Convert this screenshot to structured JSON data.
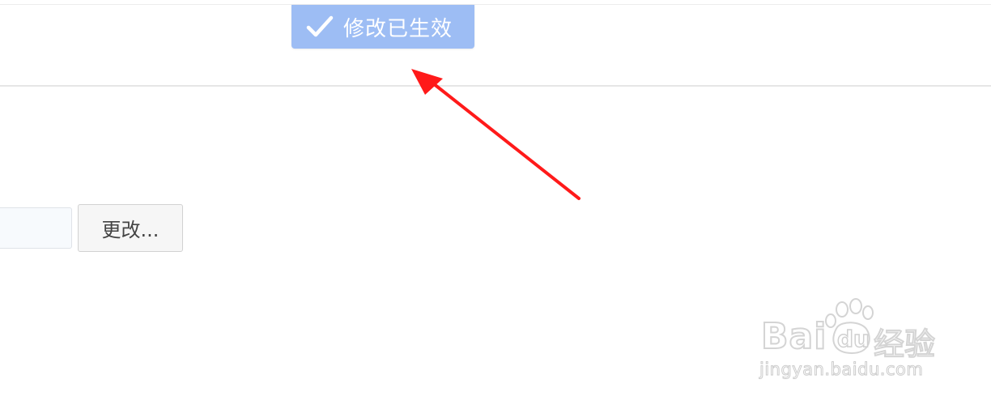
{
  "toast": {
    "icon": "check-icon",
    "message": "修改已生效",
    "background_color": "#9dbdf4"
  },
  "setting": {
    "input_value": "",
    "change_button_label": "更改..."
  },
  "annotation": {
    "arrow_color": "#ff1a1a"
  },
  "watermark": {
    "brand": "Bai",
    "brand_badge": "du",
    "brand_suffix": "经验",
    "url": "jingyan.baidu.com"
  }
}
